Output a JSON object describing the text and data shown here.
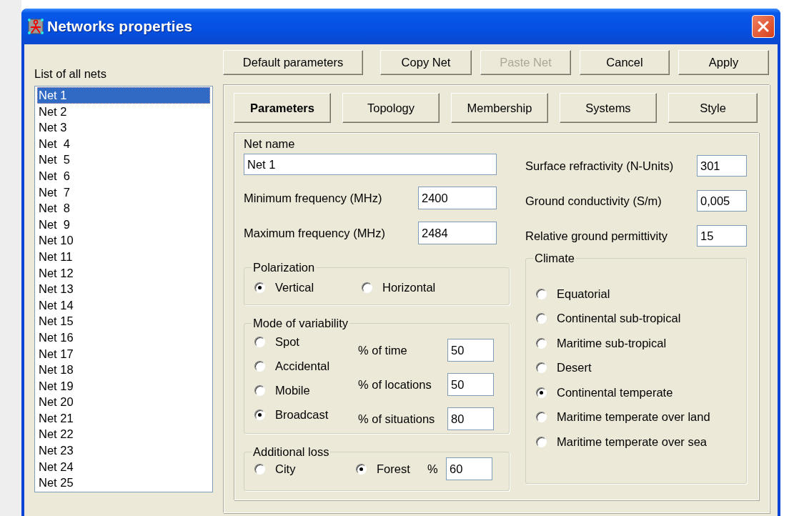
{
  "window": {
    "title": "Networks properties"
  },
  "net_list": {
    "label": "List of all nets",
    "items": [
      {
        "label": "Net 1",
        "selected": true
      },
      {
        "label": "Net 2",
        "selected": false
      },
      {
        "label": "Net 3",
        "selected": false
      },
      {
        "label": "Net  4",
        "selected": false
      },
      {
        "label": "Net  5",
        "selected": false
      },
      {
        "label": "Net  6",
        "selected": false
      },
      {
        "label": "Net  7",
        "selected": false
      },
      {
        "label": "Net  8",
        "selected": false
      },
      {
        "label": "Net  9",
        "selected": false
      },
      {
        "label": "Net 10",
        "selected": false
      },
      {
        "label": "Net 11",
        "selected": false
      },
      {
        "label": "Net 12",
        "selected": false
      },
      {
        "label": "Net 13",
        "selected": false
      },
      {
        "label": "Net 14",
        "selected": false
      },
      {
        "label": "Net 15",
        "selected": false
      },
      {
        "label": "Net 16",
        "selected": false
      },
      {
        "label": "Net 17",
        "selected": false
      },
      {
        "label": "Net 18",
        "selected": false
      },
      {
        "label": "Net 19",
        "selected": false
      },
      {
        "label": "Net 20",
        "selected": false
      },
      {
        "label": "Net 21",
        "selected": false
      },
      {
        "label": "Net 22",
        "selected": false
      },
      {
        "label": "Net 23",
        "selected": false
      },
      {
        "label": "Net 24",
        "selected": false
      },
      {
        "label": "Net 25",
        "selected": false
      }
    ]
  },
  "buttons": [
    {
      "label": "Default parameters",
      "disabled": false
    },
    {
      "label": "Copy Net",
      "disabled": false
    },
    {
      "label": "Paste Net",
      "disabled": true
    },
    {
      "label": "Cancel",
      "disabled": false
    },
    {
      "label": "Apply",
      "disabled": false
    }
  ],
  "tabs": [
    {
      "label": "Parameters",
      "selected": true
    },
    {
      "label": "Topology",
      "selected": false
    },
    {
      "label": "Membership",
      "selected": false
    },
    {
      "label": "Systems",
      "selected": false
    },
    {
      "label": "Style",
      "selected": false
    }
  ],
  "parameters": {
    "net_name": {
      "label": "Net name",
      "value": "Net 1"
    },
    "left_fields": [
      {
        "label": "Minimum frequency (MHz)",
        "value": "2400"
      },
      {
        "label": "Maximum frequency (MHz)",
        "value": "2484"
      }
    ],
    "right_fields": [
      {
        "label": "Surface refractivity (N-Units)",
        "value": "301"
      },
      {
        "label": "Ground conductivity (S/m)",
        "value": "0,005"
      },
      {
        "label": "Relative ground permittivity",
        "value": "15"
      }
    ]
  },
  "polarization": {
    "title": "Polarization",
    "options": [
      {
        "label": "Vertical",
        "selected": true
      },
      {
        "label": "Horizontal",
        "selected": false
      }
    ]
  },
  "variability": {
    "title": "Mode of variability",
    "options": [
      {
        "label": "Spot",
        "selected": false
      },
      {
        "label": "Accidental",
        "selected": false
      },
      {
        "label": "Mobile",
        "selected": false
      },
      {
        "label": "Broadcast",
        "selected": true
      }
    ],
    "fields": [
      {
        "label": "% of time",
        "value": "50"
      },
      {
        "label": "% of locations",
        "value": "50"
      },
      {
        "label": "% of situations",
        "value": "80"
      }
    ]
  },
  "additional_loss": {
    "title": "Additional loss",
    "options": [
      {
        "label": "City",
        "selected": false
      },
      {
        "label": "Forest",
        "selected": true
      }
    ],
    "percent": {
      "label": "%",
      "value": "60"
    }
  },
  "climate": {
    "title": "Climate",
    "options": [
      {
        "label": "Equatorial",
        "selected": false
      },
      {
        "label": "Continental sub-tropical",
        "selected": false
      },
      {
        "label": "Maritime sub-tropical",
        "selected": false
      },
      {
        "label": "Desert",
        "selected": false
      },
      {
        "label": "Continental temperate",
        "selected": true
      },
      {
        "label": "Maritime temperate over land",
        "selected": false
      },
      {
        "label": "Maritime temperate over sea",
        "selected": false
      }
    ]
  }
}
